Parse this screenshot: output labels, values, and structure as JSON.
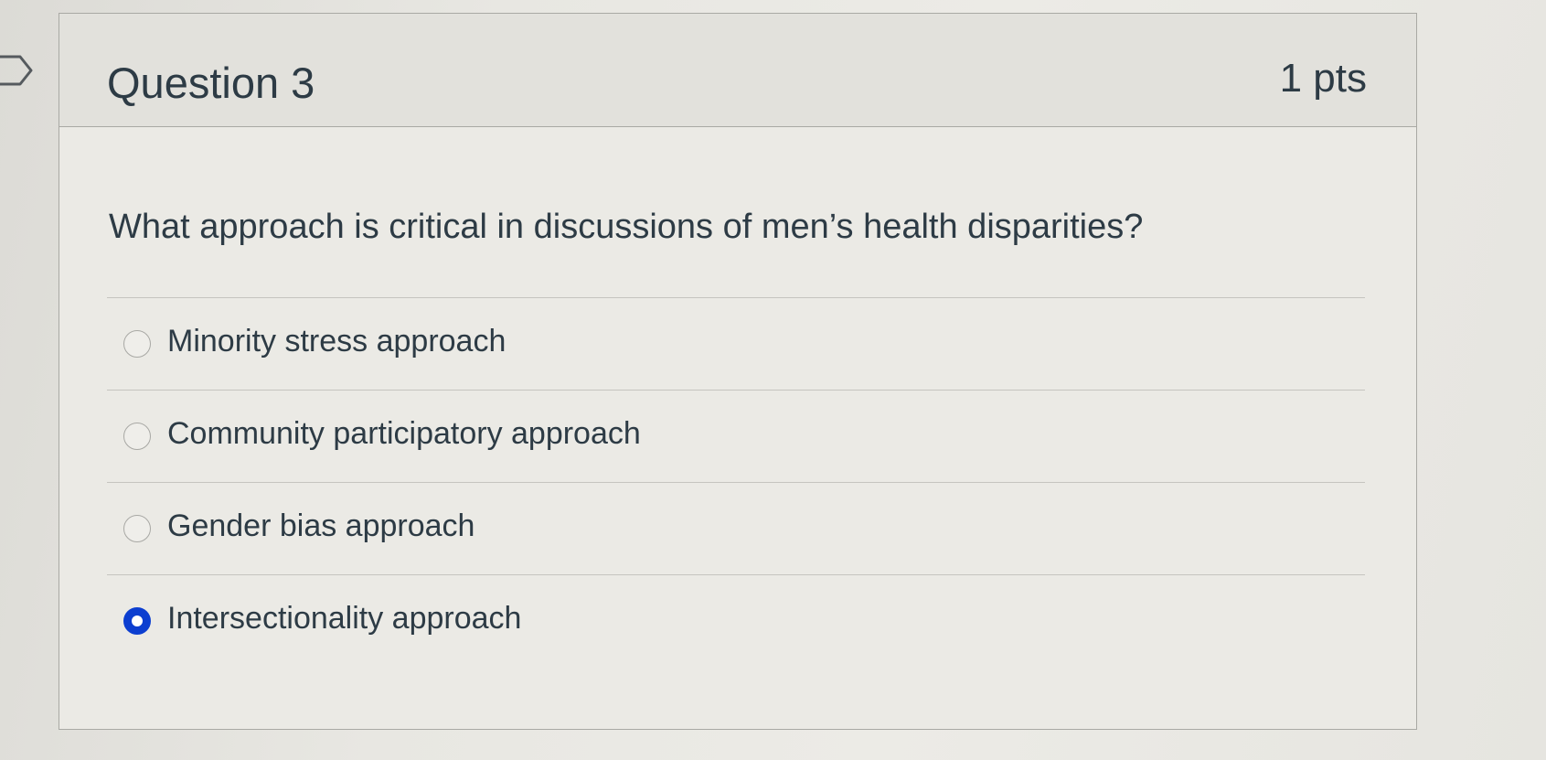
{
  "question": {
    "title": "Question 3",
    "points": "1 pts",
    "text": "What approach is critical in discussions of men’s health disparities?",
    "answers": [
      {
        "label": "Minority stress approach",
        "selected": false
      },
      {
        "label": "Community participatory approach",
        "selected": false
      },
      {
        "label": "Gender bias approach",
        "selected": false
      },
      {
        "label": "Intersectionality approach",
        "selected": true
      }
    ]
  },
  "colors": {
    "selected_radio": "#0c3ed0",
    "text": "#2d3b45"
  },
  "icons": {
    "flag": "flag-icon"
  }
}
